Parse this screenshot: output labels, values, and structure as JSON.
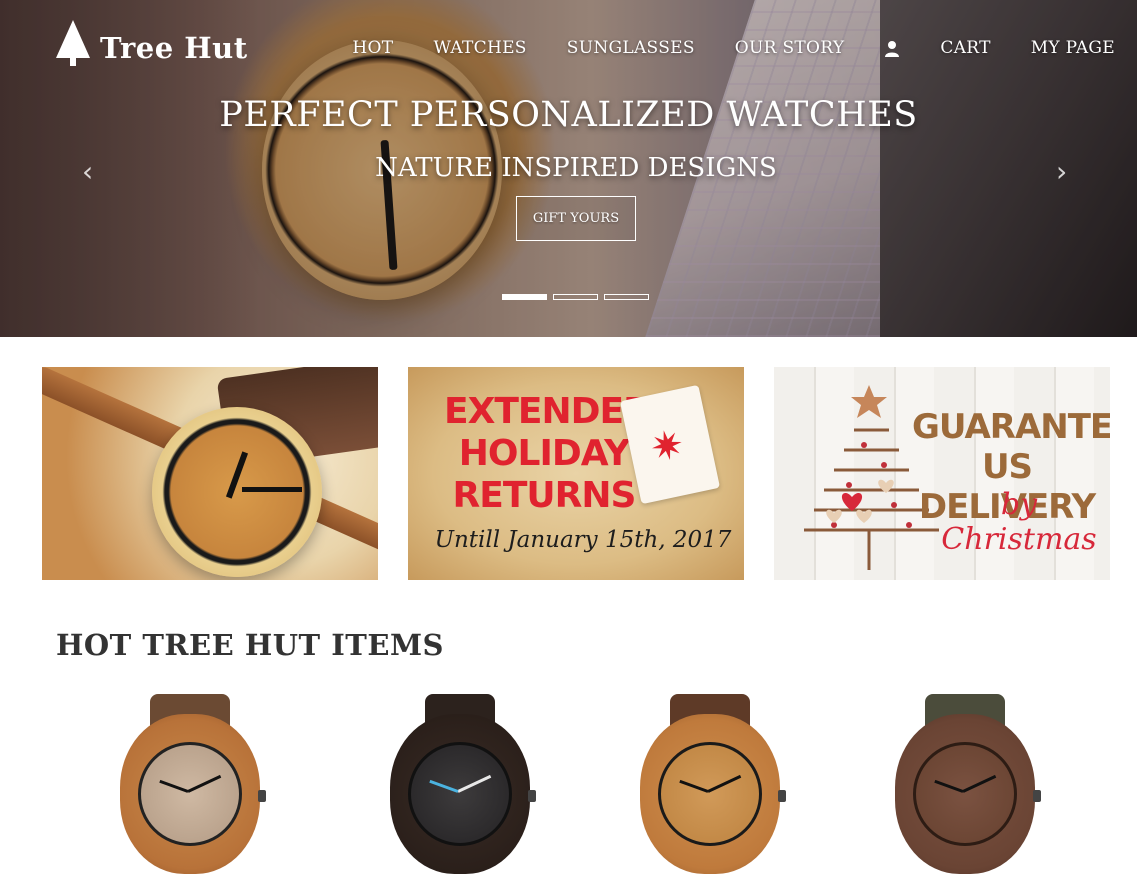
{
  "brand": {
    "name": "Tree Hut"
  },
  "nav": {
    "items": [
      {
        "label": "HOT"
      },
      {
        "label": "WATCHES"
      },
      {
        "label": "SUNGLASSES"
      },
      {
        "label": "OUR STORY"
      },
      {
        "label": "CART"
      },
      {
        "label": "MY PAGE"
      }
    ],
    "account_icon": "user-icon"
  },
  "hero": {
    "title": "PERFECT PERSONALIZED WATCHES",
    "subtitle": "NATURE INSPIRED DESIGNS",
    "cta": "GIFT YOURS",
    "prev_arrow": "‹",
    "next_arrow": "›",
    "slides_total": 3,
    "active_slide": 1
  },
  "promos": [
    {
      "alt": "wooden watch"
    },
    {
      "lines": [
        "EXTENDED",
        "HOLIDAY",
        "RETURNS"
      ],
      "sub": "Untill January 15th, 2017"
    },
    {
      "lines": [
        "GUARANTEED",
        "US DELIVERY"
      ],
      "sub": "by Christmas"
    }
  ],
  "section": {
    "title": "HOT TREE HUT ITEMS"
  },
  "colors": {
    "promo_red": "#e0232f",
    "promo_brown": "#9c6a3a",
    "promo_christmas_red": "#d7283a"
  }
}
